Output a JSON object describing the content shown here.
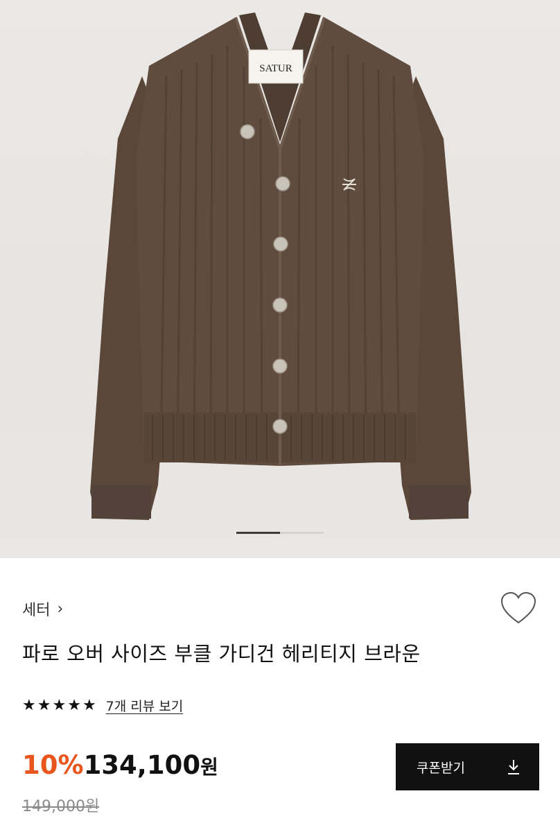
{
  "product": {
    "brand_label": "SATUR",
    "category": "세터",
    "title": "파로 오버 사이즈 부클 가디건 헤리티지 브라운",
    "rating_stars": 5,
    "review_link": "7개 리뷰 보기",
    "discount": "10%",
    "price": "134,100",
    "price_unit": "원",
    "original_price": "149,000원",
    "coupon_label": "쿠폰받기"
  },
  "gallery": {
    "active_index": 1,
    "total": 2
  },
  "colors": {
    "accent": "#e8561e",
    "dark": "#111111",
    "knit": "#5e4b3e"
  },
  "icons": {
    "category_chevron": "chevron-right-icon",
    "wish": "heart-outline-icon",
    "download": "download-icon",
    "star": "star-icon"
  }
}
